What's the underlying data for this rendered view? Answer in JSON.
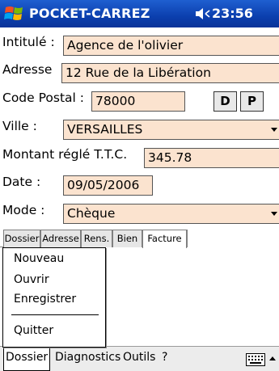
{
  "titlebar": {
    "app_title": "POCKET-CARREZ",
    "clock": "23:56"
  },
  "form": {
    "intitule_label": "Intitulé :",
    "intitule_value": "Agence de l'olivier",
    "adresse_label": "Adresse",
    "adresse_value": "12 Rue de la Libération",
    "code_postal_label": "Code Postal :",
    "code_postal_value": "78000",
    "btn_d": "D",
    "btn_p": "P",
    "ville_label": "Ville :",
    "ville_value": "VERSAILLES",
    "montant_label": "Montant réglé T.T.C.",
    "montant_value": "345.78",
    "date_label": "Date :",
    "date_value": "09/05/2006",
    "mode_label": "Mode :",
    "mode_value": "Chèque"
  },
  "tabs": [
    {
      "label": "Dossier"
    },
    {
      "label": "Adresse"
    },
    {
      "label": "Rens."
    },
    {
      "label": "Bien"
    },
    {
      "label": "Facture"
    }
  ],
  "menu": {
    "items": [
      "Nouveau",
      "Ouvrir",
      "Enregistrer",
      "Quitter"
    ]
  },
  "menubar": {
    "items": [
      "Dossier",
      "Diagnostics",
      "Outils",
      "?"
    ]
  },
  "colors": {
    "field_bg": "#fbe3cf",
    "titlebar": "#0b3fae"
  },
  "icons": {
    "start": "windows-flag-icon",
    "volume": "speaker-icon",
    "keyboard": "keyboard-icon",
    "sip": "up-arrow-icon"
  }
}
